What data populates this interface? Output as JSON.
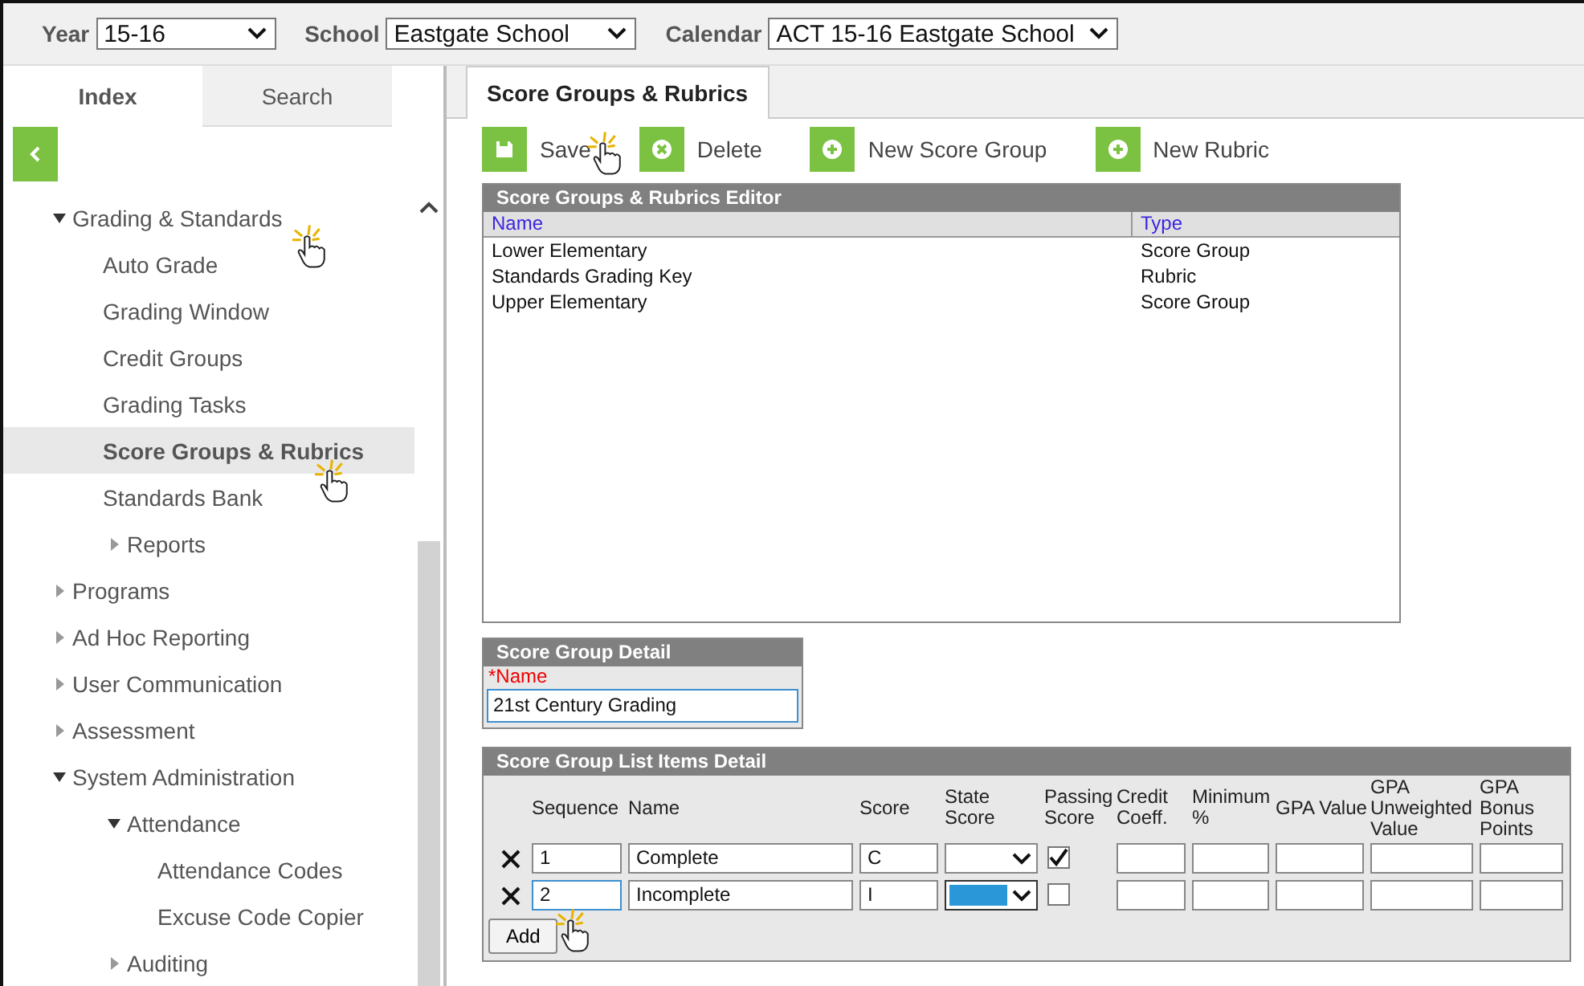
{
  "toolbar": {
    "fields": [
      {
        "label": "Year",
        "value": "15-16"
      },
      {
        "label": "School",
        "value": "Eastgate School"
      },
      {
        "label": "Calendar",
        "value": "ACT 15-16 Eastgate School"
      }
    ]
  },
  "sidebar": {
    "tabs": [
      {
        "label": "Index",
        "selected": true
      },
      {
        "label": "Search",
        "selected": false
      }
    ],
    "items": [
      {
        "kind": "folder",
        "label": "Grading & Standards",
        "expanded": true,
        "children": [
          {
            "kind": "page",
            "label": "Auto Grade",
            "selected": false
          },
          {
            "kind": "page",
            "label": "Grading Window",
            "selected": false
          },
          {
            "kind": "page",
            "label": "Credit Groups",
            "selected": false
          },
          {
            "kind": "page",
            "label": "Grading Tasks",
            "selected": false
          },
          {
            "kind": "page",
            "label": "Score Groups & Rubrics",
            "selected": true
          },
          {
            "kind": "page",
            "label": "Standards Bank",
            "selected": false
          },
          {
            "kind": "folder",
            "label": "Reports",
            "expanded": false
          }
        ]
      },
      {
        "kind": "folder",
        "label": "Programs",
        "expanded": false
      },
      {
        "kind": "folder",
        "label": "Ad Hoc Reporting",
        "expanded": false
      },
      {
        "kind": "folder",
        "label": "User Communication",
        "expanded": false
      },
      {
        "kind": "folder",
        "label": "Assessment",
        "expanded": false
      },
      {
        "kind": "folder",
        "label": "System Administration",
        "expanded": true,
        "children": [
          {
            "kind": "folder",
            "label": "Attendance",
            "expanded": true,
            "children": [
              {
                "kind": "page",
                "label": "Attendance Codes",
                "selected": false
              },
              {
                "kind": "page",
                "label": "Excuse Code Copier",
                "selected": false
              }
            ]
          },
          {
            "kind": "folder",
            "label": "Auditing",
            "expanded": false
          }
        ]
      }
    ]
  },
  "main": {
    "tabs": [
      {
        "label": "Score Groups & Rubrics",
        "selected": true
      }
    ],
    "actions": [
      {
        "kind": "save",
        "label": "Save"
      },
      {
        "kind": "delete",
        "label": "Delete"
      },
      {
        "kind": "add",
        "label": "New Score Group"
      },
      {
        "kind": "add",
        "label": "New Rubric"
      }
    ],
    "editor": {
      "title": "Score Groups & Rubrics Editor",
      "columns": [
        "Name",
        "Type"
      ],
      "rows": [
        [
          "Lower Elementary",
          "Score Group"
        ],
        [
          "Standards Grading Key",
          "Rubric"
        ],
        [
          "Upper Elementary",
          "Score Group"
        ]
      ]
    },
    "detail": {
      "title": "Score Group Detail",
      "field_label": "*Name",
      "value": "21st Century Grading"
    },
    "list_items": {
      "title": "Score Group List Items Detail",
      "columns": [
        "Sequence",
        "Name",
        "Score",
        "State Score",
        "Passing Score",
        "Credit Coeff.",
        "Minimum %",
        "GPA Value",
        "GPA Unweighted Value",
        "GPA Bonus Points"
      ],
      "rows": [
        {
          "sequence": "1",
          "name": "Complete",
          "score": "C",
          "passing": true,
          "focused": false
        },
        {
          "sequence": "2",
          "name": "Incomplete",
          "score": "I",
          "passing": false,
          "focused": true
        }
      ],
      "add_button": "Add"
    }
  }
}
